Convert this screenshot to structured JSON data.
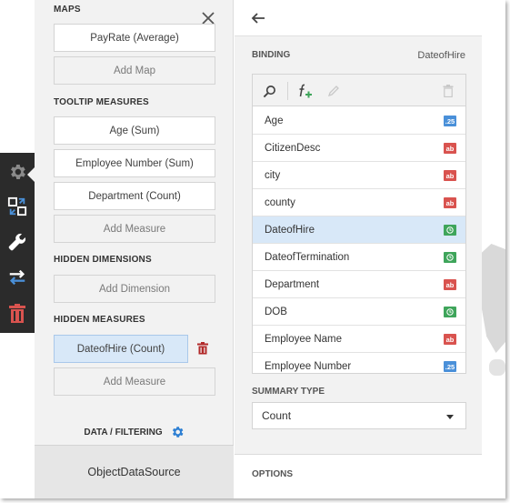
{
  "binding_panel": {
    "maps_title": "MAPS",
    "maps_item": "PayRate (Average)",
    "add_map": "Add Map",
    "tooltip_title": "TOOLTIP MEASURES",
    "tooltip_items": [
      "Age (Sum)",
      "Employee Number (Sum)",
      "Department (Count)"
    ],
    "add_measure": "Add Measure",
    "hidden_dimensions_title": "HIDDEN DIMENSIONS",
    "add_dimension": "Add Dimension",
    "hidden_measures_title": "HIDDEN MEASURES",
    "hidden_measure_item": "DateofHire (Count)",
    "add_measure_2": "Add Measure",
    "data_filtering": "DATA / FILTERING",
    "datasource": "ObjectDataSource"
  },
  "field_panel": {
    "binding_label": "BINDING",
    "binding_value": "DateofHire",
    "fields": [
      {
        "name": "Age",
        "type": "num",
        "badge": ".25"
      },
      {
        "name": "CitizenDesc",
        "type": "str",
        "badge": "ab"
      },
      {
        "name": "city",
        "type": "str",
        "badge": "ab"
      },
      {
        "name": "county",
        "type": "str",
        "badge": "ab"
      },
      {
        "name": "DateofHire",
        "type": "date",
        "badge": "",
        "selected": true
      },
      {
        "name": "DateofTermination",
        "type": "date",
        "badge": ""
      },
      {
        "name": "Department",
        "type": "str",
        "badge": "ab"
      },
      {
        "name": "DOB",
        "type": "date",
        "badge": ""
      },
      {
        "name": "Employee Name",
        "type": "str",
        "badge": "ab"
      },
      {
        "name": "Employee Number",
        "type": "num",
        "badge": ".25"
      }
    ],
    "summary_type_label": "SUMMARY TYPE",
    "summary_type_value": "Count",
    "options_label": "OPTIONS"
  },
  "icons": [
    "gear-icon",
    "convert-icon",
    "wrench-icon",
    "swap-icon",
    "trash-icon",
    "close-icon",
    "back-arrow-icon",
    "search-icon",
    "add-calculated-field-icon",
    "edit-icon",
    "delete-icon",
    "settings-gear-icon",
    "delete-measure-icon"
  ],
  "colors": {
    "toolbar_bg": "#2b2b2b",
    "tool_icon": "#ffffff",
    "tool_accent_blue": "#4a90d9",
    "trash_red": "#d9534f",
    "selected_bg": "#d8e8f8",
    "gear_blue": "#2d7fd3"
  }
}
